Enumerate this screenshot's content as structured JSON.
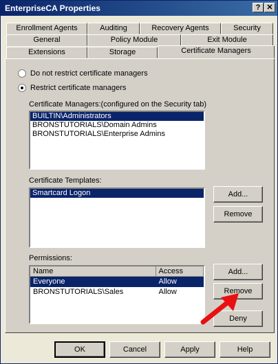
{
  "window": {
    "title": "EnterpriseCA Properties",
    "help_glyph": "?",
    "close_glyph": "✕"
  },
  "tabs": {
    "row1": [
      "Enrollment Agents",
      "Auditing",
      "Recovery Agents",
      "Security"
    ],
    "row2": [
      "General",
      "Policy Module",
      "Exit Module"
    ],
    "row3": [
      "Extensions",
      "Storage",
      "Certificate Managers"
    ]
  },
  "managers_mode": {
    "option_unrestricted": "Do not restrict certificate managers",
    "option_restricted": "Restrict certificate managers"
  },
  "managers": {
    "label": "Certificate Managers:(configured on the Security tab)",
    "items": [
      "BUILTIN\\Administrators",
      "BRONSTUTORIALS\\Domain Admins",
      "BRONSTUTORIALS\\Enterprise Admins"
    ]
  },
  "templates": {
    "label": "Certificate Templates:",
    "items": [
      "Smartcard Logon"
    ],
    "add": "Add...",
    "remove": "Remove"
  },
  "permissions": {
    "label": "Permissions:",
    "columns": [
      "Name",
      "Access"
    ],
    "rows": [
      {
        "name": "Everyone",
        "access": "Allow"
      },
      {
        "name": "BRONSTUTORIALS\\Sales",
        "access": "Allow"
      }
    ],
    "add": "Add...",
    "remove": "Remove",
    "deny": "Deny"
  },
  "footer": {
    "ok": "OK",
    "cancel": "Cancel",
    "apply": "Apply",
    "help": "Help"
  },
  "colors": {
    "selection": "#0a246a",
    "arrow": "#e81010",
    "face": "#d4d0c8"
  }
}
